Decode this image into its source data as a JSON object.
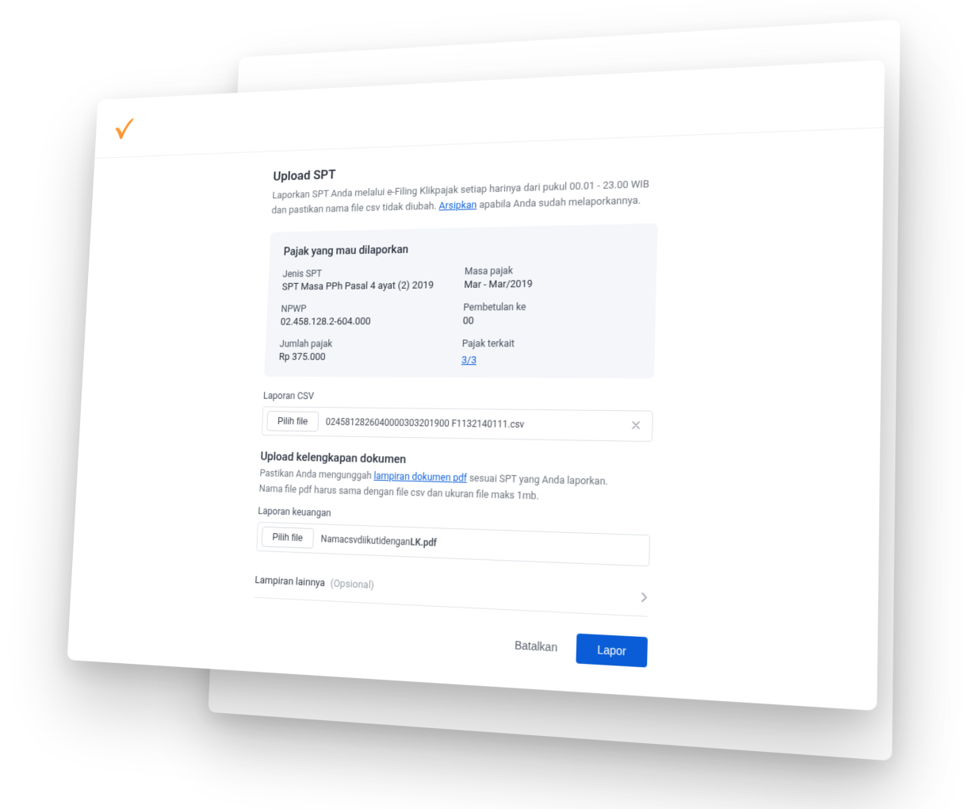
{
  "header": {
    "logo_name": "check-logo"
  },
  "page": {
    "title": "Upload SPT",
    "subtitle_a": "Laporkan SPT Anda melalui e-Filing Klikpajak setiap harinya dari pukul 00.01 - 23.00 WIB dan pastikan nama file csv tidak diubah.",
    "subtitle_link": "Arsipkan",
    "subtitle_b": " apabila Anda sudah melaporkannya."
  },
  "info": {
    "title": "Pajak yang mau dilaporkan",
    "items": {
      "jenis_label": "Jenis SPT",
      "jenis_value": "SPT Masa PPh Pasal 4 ayat (2) 2019",
      "masa_label": "Masa pajak",
      "masa_value": "Mar - Mar/2019",
      "npwp_label": "NPWP",
      "npwp_value": "02.458.128.2-604.000",
      "pembetulan_label": "Pembetulan ke",
      "pembetulan_value": "00",
      "jumlah_label": "Jumlah pajak",
      "jumlah_value": "Rp 375.000",
      "terkait_label": "Pajak terkait",
      "terkait_link": "3/3"
    }
  },
  "csv": {
    "label": "Laporan CSV",
    "choose": "Pilih file",
    "filename": "0245812826040000303201900 F1132140111.csv"
  },
  "docs": {
    "title": "Upload kelengkapan dokumen",
    "sub_a": "Pastikan Anda mengunggah ",
    "sub_link": "lampiran dokumen pdf",
    "sub_b": " sesuai SPT yang Anda laporkan.",
    "sub_c": "Nama file pdf harus sama dengan file csv dan ukuran file maks 1mb.",
    "keuangan_label": "Laporan keuangan",
    "keuangan_choose": "Pilih file",
    "keuangan_file_prefix": "Namacsvdiikutidengan",
    "keuangan_file_bold": "LK.pdf",
    "lampiran_label": "Lampiran lainnya",
    "lampiran_optional": "(Opsional)"
  },
  "actions": {
    "cancel": "Batalkan",
    "submit": "Lapor"
  }
}
